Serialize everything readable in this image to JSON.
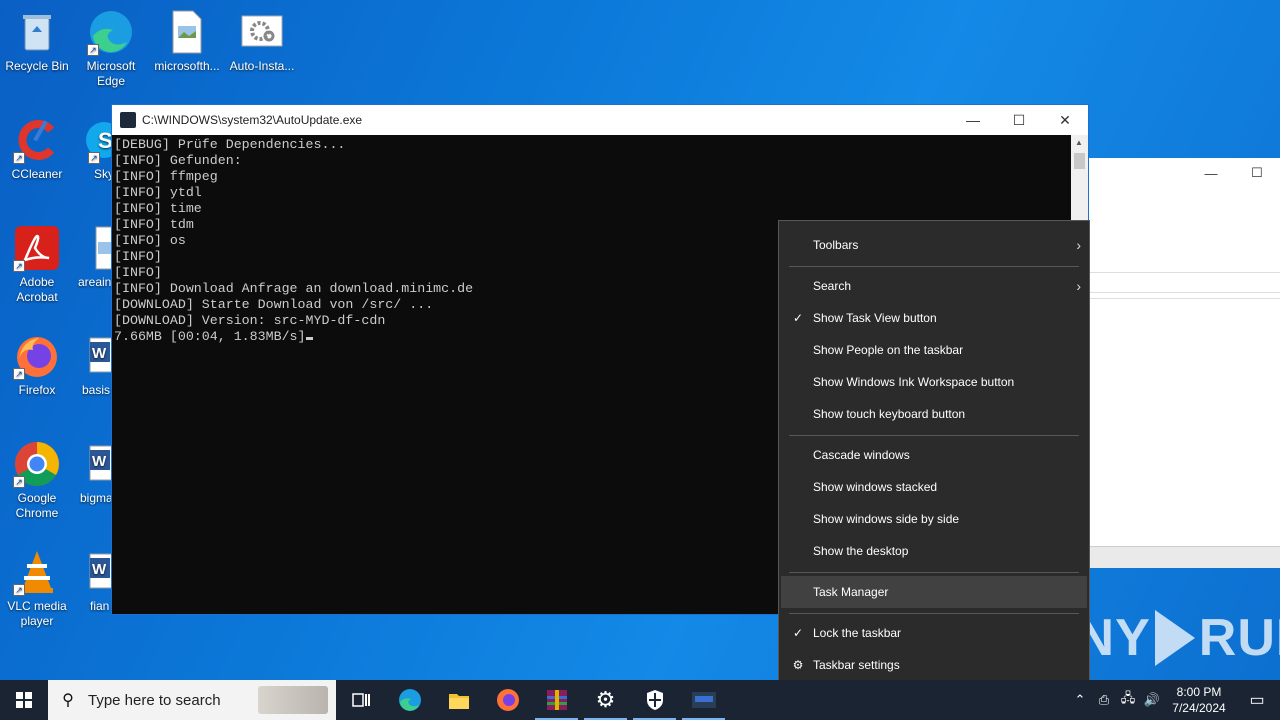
{
  "desktop": {
    "icons": [
      {
        "label": "Recycle Bin",
        "icon": "recycle-bin-icon"
      },
      {
        "label": "Microsoft Edge",
        "icon": "edge-icon"
      },
      {
        "label": "microsofth...",
        "icon": "image-file-icon"
      },
      {
        "label": "Auto-Insta...",
        "icon": "settings-file-icon"
      },
      {
        "label": "CCleaner",
        "icon": "ccleaner-icon"
      },
      {
        "label": "Sky",
        "icon": "skype-icon"
      },
      {
        "label": "Adobe Acrobat",
        "icon": "acrobat-icon"
      },
      {
        "label": "areain",
        "icon": "image-file-icon"
      },
      {
        "label": "Firefox",
        "icon": "firefox-icon"
      },
      {
        "label": "basis",
        "icon": "word-doc-icon"
      },
      {
        "label": "Google Chrome",
        "icon": "chrome-icon"
      },
      {
        "label": "bigma",
        "icon": "word-doc-icon"
      },
      {
        "label": "VLC media player",
        "icon": "vlc-icon"
      },
      {
        "label": "fian",
        "icon": "word-doc-icon"
      }
    ]
  },
  "console": {
    "title": "C:\\WINDOWS\\system32\\AutoUpdate.exe",
    "minimize": "—",
    "maximize": "☐",
    "close": "✕",
    "lines": [
      "[DEBUG] Prüfe Dependencies...",
      "[INFO] Gefunden:",
      "[INFO] ffmpeg",
      "[INFO] ytdl",
      "[INFO] time",
      "[INFO] tdm",
      "[INFO] os",
      "[INFO]",
      "[INFO]",
      "[INFO] Download Anfrage an download.minimc.de",
      "[DOWNLOAD] Starte Download von /src/ ...",
      "[DOWNLOAD] Version: src-MYD-df-cdn",
      "7.66MB [00:04, 1.83MB/s]"
    ]
  },
  "context_menu": {
    "items": [
      {
        "label": "Toolbars",
        "submenu": true,
        "checked": false
      },
      {
        "label": "Search",
        "submenu": true,
        "checked": false
      },
      {
        "label": "Show Task View button",
        "submenu": false,
        "checked": true
      },
      {
        "label": "Show People on the taskbar",
        "submenu": false,
        "checked": false
      },
      {
        "label": "Show Windows Ink Workspace button",
        "submenu": false,
        "checked": false
      },
      {
        "label": "Show touch keyboard button",
        "submenu": false,
        "checked": false
      },
      {
        "label": "Cascade windows",
        "submenu": false,
        "checked": false
      },
      {
        "label": "Show windows stacked",
        "submenu": false,
        "checked": false
      },
      {
        "label": "Show windows side by side",
        "submenu": false,
        "checked": false
      },
      {
        "label": "Show the desktop",
        "submenu": false,
        "checked": false
      },
      {
        "label": "Task Manager",
        "submenu": false,
        "checked": false,
        "highlighted": true
      },
      {
        "label": "Lock the taskbar",
        "submenu": false,
        "checked": true
      },
      {
        "label": "Taskbar settings",
        "submenu": false,
        "checked": false,
        "icon": "gear-icon"
      }
    ]
  },
  "watermark": {
    "left": "ANY",
    "right": "RUN"
  },
  "taskbar": {
    "search_placeholder": "Type here to search",
    "apps": [
      "task-view-icon",
      "edge-icon",
      "file-explorer-icon",
      "firefox-icon",
      "winrar-icon",
      "settings-icon",
      "security-icon",
      "console-app-icon"
    ],
    "time": "8:00 PM",
    "date": "7/24/2024"
  },
  "colors": {
    "desktop": "#0b78d8",
    "taskbar": "#1b2433",
    "menu": "#2b2b2b",
    "menu_highlight": "#414141",
    "console_bg": "#0c0c0c",
    "console_text": "#cccccc"
  }
}
